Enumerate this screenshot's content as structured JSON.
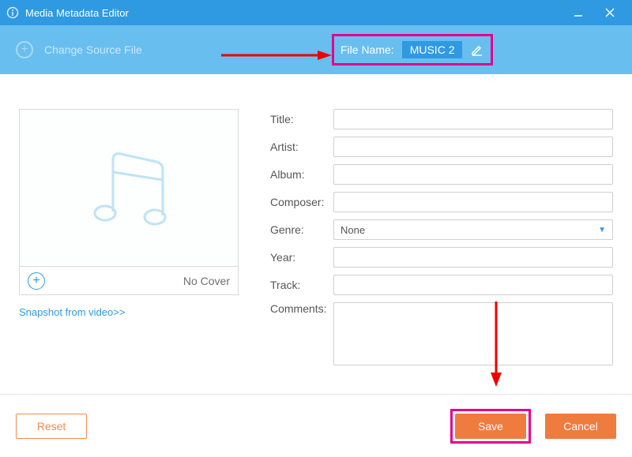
{
  "titlebar": {
    "title": "Media Metadata Editor"
  },
  "toolbar": {
    "change_source": "Change Source File",
    "filename_label": "File Name:",
    "filename_value": "MUSIC 2"
  },
  "cover": {
    "no_cover": "No Cover",
    "snapshot_link": "Snapshot from video>>"
  },
  "form": {
    "title_label": "Title:",
    "artist_label": "Artist:",
    "album_label": "Album:",
    "composer_label": "Composer:",
    "genre_label": "Genre:",
    "genre_value": "None",
    "year_label": "Year:",
    "track_label": "Track:",
    "comments_label": "Comments:",
    "values": {
      "title": "",
      "artist": "",
      "album": "",
      "composer": "",
      "year": "",
      "track": "",
      "comments": ""
    }
  },
  "footer": {
    "reset": "Reset",
    "save": "Save",
    "cancel": "Cancel"
  }
}
